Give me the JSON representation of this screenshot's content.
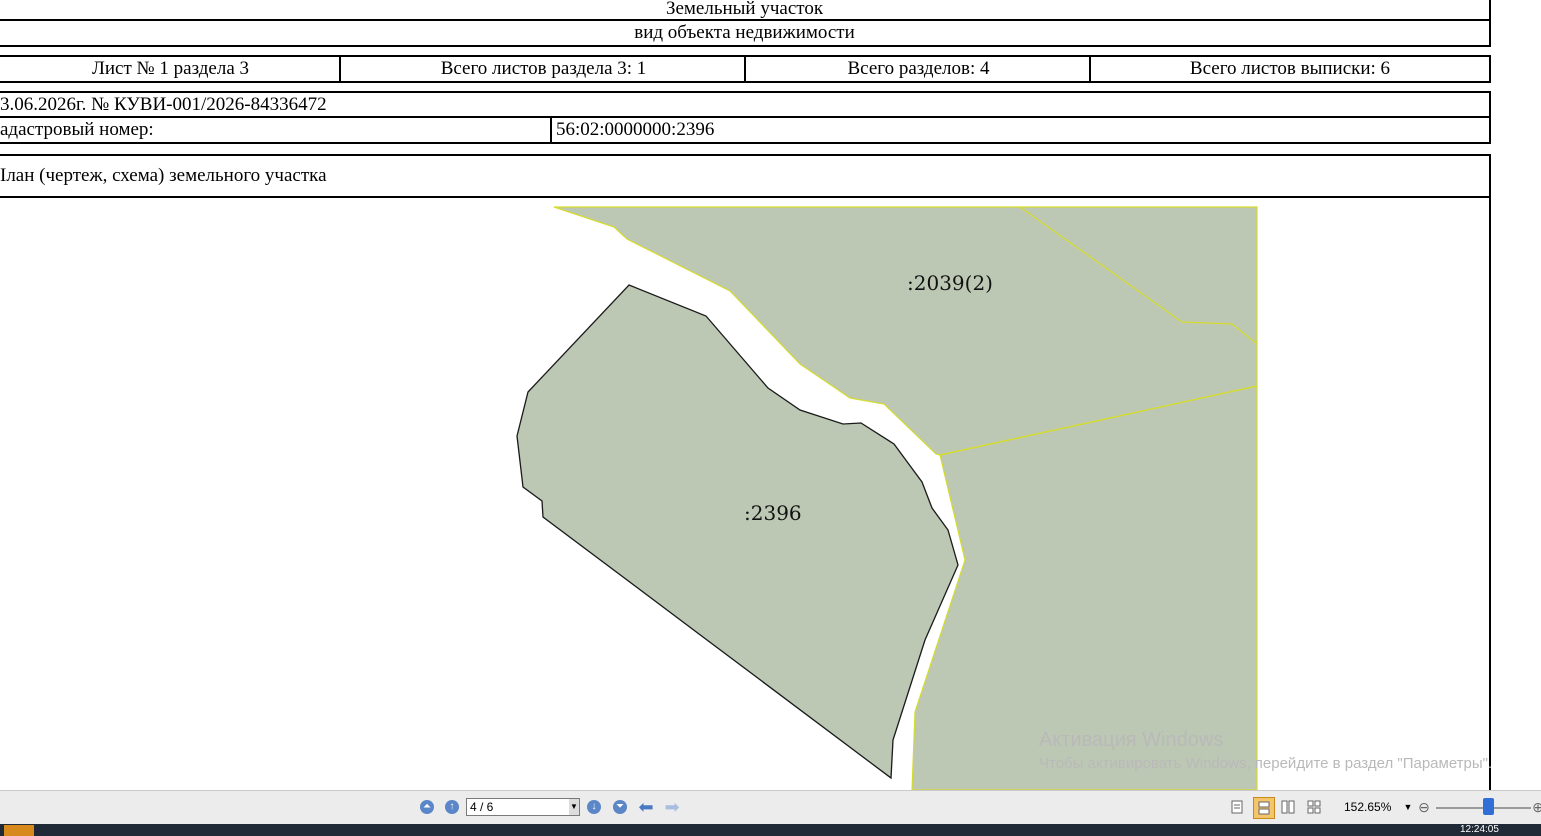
{
  "header": {
    "title": "Земельный участок",
    "subtitle": "вид объекта недвижимости"
  },
  "sheet_row": {
    "sheet": "Лист № 1 раздела 3",
    "total_sheets_section": "Всего листов раздела 3: 1",
    "total_sections": "Всего разделов: 4",
    "total_sheets_extract": "Всего листов выписки: 6"
  },
  "doc_info": {
    "date_number": "3.06.2026г. № КУВИ-001/2026-84336472",
    "cadastral_label": "адастровый номер:",
    "cadastral_value": "56:02:0000000:2396"
  },
  "plan": {
    "title": "Ілан (чертеж, схема) земельного участка",
    "label_main": ":2396",
    "label_neighbor": ":2039(2)",
    "fill_color": "#bcc8b4",
    "border_color": "#d6dc2c"
  },
  "watermark": {
    "line1": "Активация Windows",
    "line2": "Чтобы активировать Windows, перейдите в раздел \"Параметры\"."
  },
  "toolbar": {
    "page_value": "4 / 6",
    "zoom": "152.65%"
  },
  "taskbar": {
    "clock": "12:24:05"
  }
}
